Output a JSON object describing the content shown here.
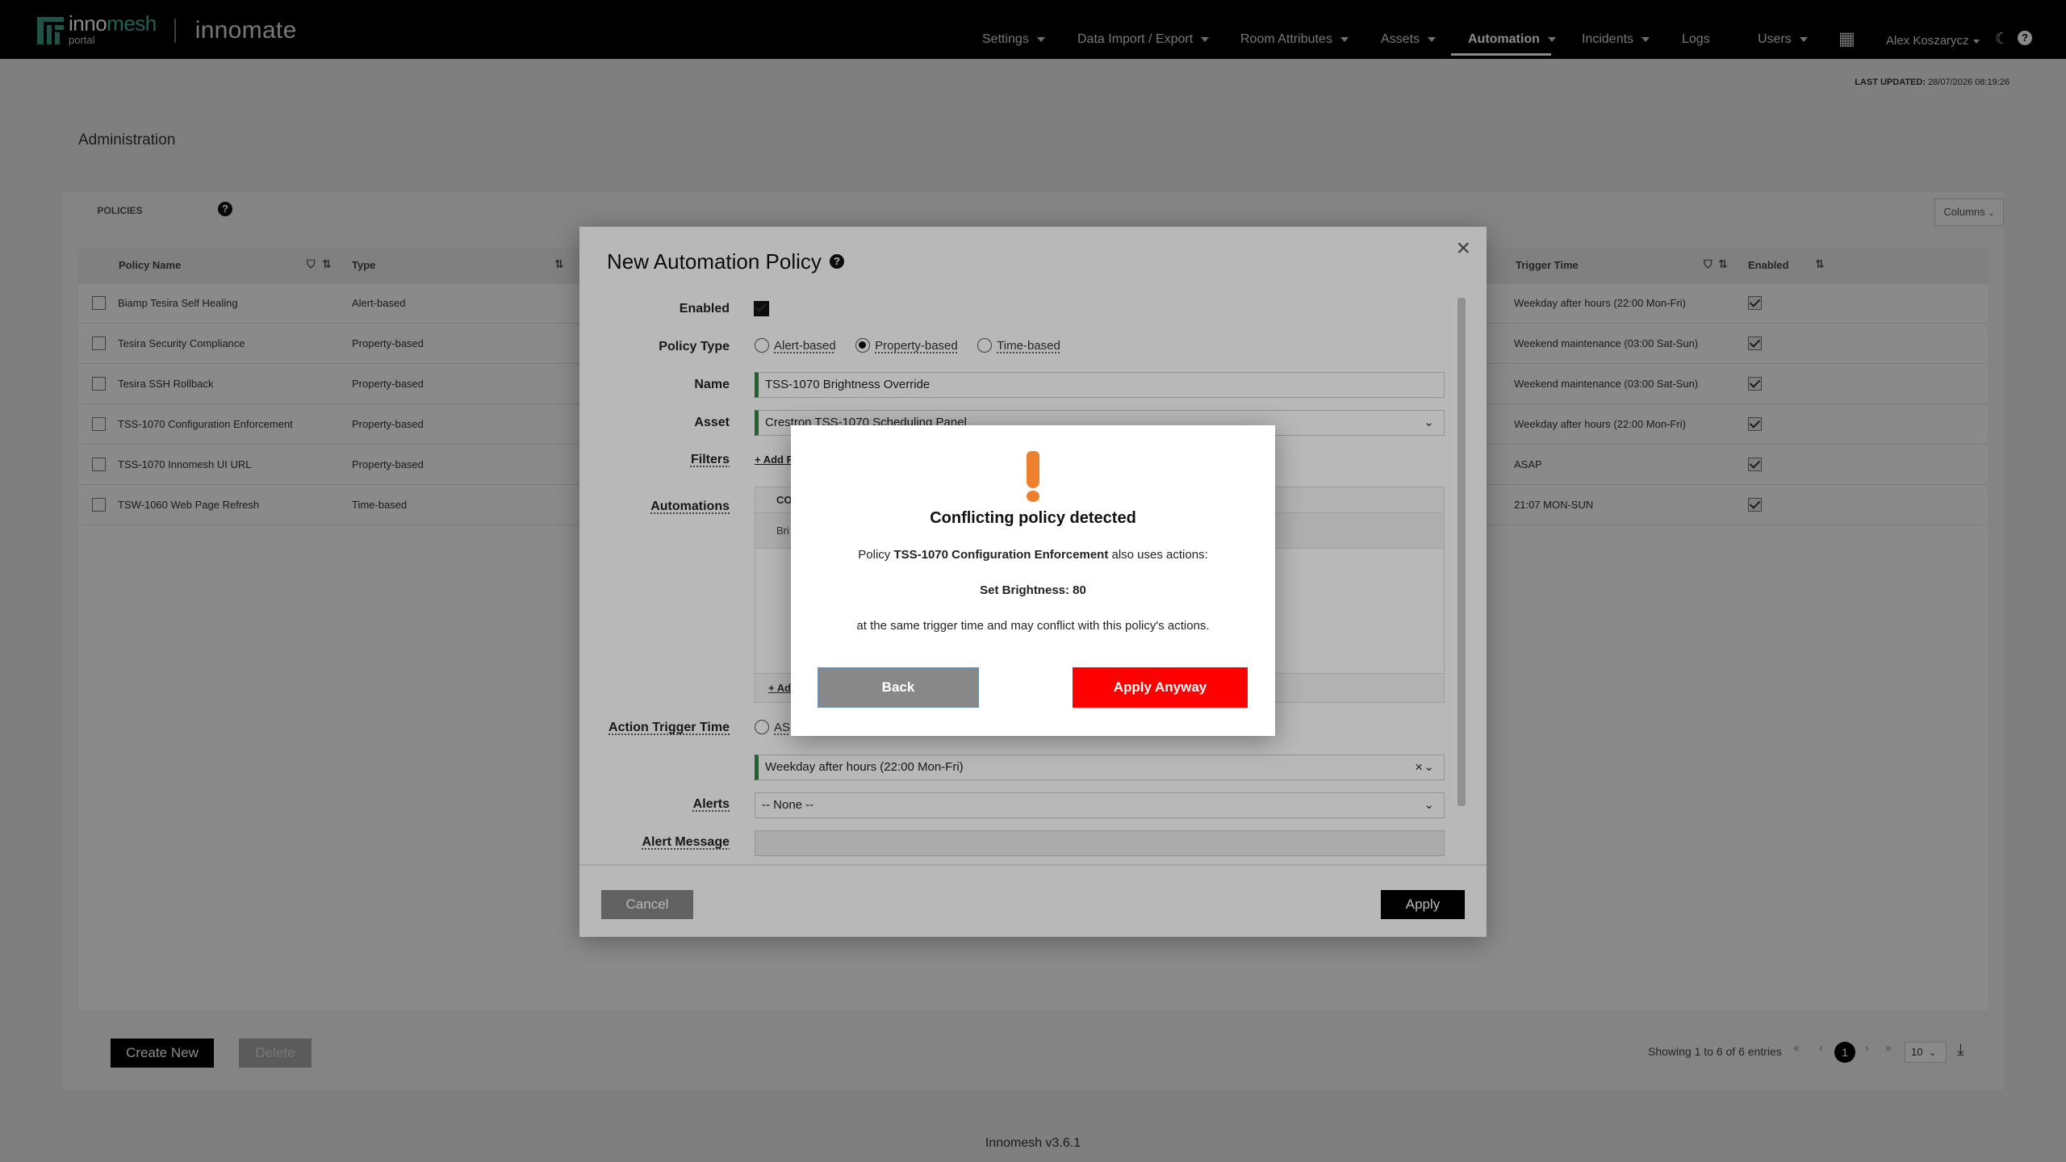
{
  "brand": {
    "logo_primary": "inno",
    "logo_accent": "mesh",
    "logo_sub": "portal",
    "product": "innomate"
  },
  "nav": {
    "items": [
      {
        "label": "Settings",
        "caret": true
      },
      {
        "label": "Data Import / Export",
        "caret": true
      },
      {
        "label": "Room Attributes",
        "caret": true
      },
      {
        "label": "Assets",
        "caret": true
      },
      {
        "label": "Automation",
        "caret": true,
        "active": true
      },
      {
        "label": "Incidents",
        "caret": true
      },
      {
        "label": "Logs",
        "caret": false
      },
      {
        "label": "Users",
        "caret": true
      }
    ],
    "user": "Alex Koszarycz",
    "icons": [
      "apps-grid-icon",
      "moon-icon",
      "help-icon"
    ]
  },
  "status": {
    "last_updated_label": "LAST UPDATED:",
    "last_updated_value": "28/07/2026 08:19:26"
  },
  "page": {
    "title": "Administration",
    "tab_policies": "POLICIES",
    "columns_button": "Columns"
  },
  "table": {
    "headers": {
      "policy_name": "Policy Name",
      "type": "Type",
      "trigger_time": "Trigger Time",
      "enabled": "Enabled"
    },
    "rows": [
      {
        "name": "Biamp Tesira Self Healing",
        "type": "Alert-based",
        "trigger": "Weekday after hours (22:00 Mon-Fri)",
        "enabled": true
      },
      {
        "name": "Tesira Security Compliance",
        "type": "Property-based",
        "trigger": "Weekend maintenance (03:00 Sat-Sun)",
        "enabled": true
      },
      {
        "name": "Tesira SSH Rollback",
        "type": "Property-based",
        "trigger": "Weekend maintenance (03:00 Sat-Sun)",
        "enabled": true
      },
      {
        "name": "TSS-1070 Configuration Enforcement",
        "type": "Property-based",
        "trigger": "Weekday after hours (22:00 Mon-Fri)",
        "enabled": true
      },
      {
        "name": "TSS-1070 Innomesh UI URL",
        "type": "Property-based",
        "trigger": "ASAP",
        "enabled": true
      },
      {
        "name": "TSW-1060 Web Page Refresh",
        "type": "Time-based",
        "trigger": "21:07 MON-SUN",
        "enabled": true
      }
    ]
  },
  "actions": {
    "create_new": "Create New",
    "delete": "Delete"
  },
  "pagination": {
    "summary": "Showing 1 to 6 of 6 entries",
    "current_page": "1",
    "page_size": "10"
  },
  "footer": {
    "version": "Innomesh v3.6.1"
  },
  "modal": {
    "title": "New Automation Policy",
    "labels": {
      "enabled": "Enabled",
      "policy_type": "Policy Type",
      "name": "Name",
      "asset": "Asset",
      "filters": "Filters",
      "automations": "Automations",
      "action_trigger_time": "Action Trigger Time",
      "alerts": "Alerts",
      "alert_message": "Alert Message"
    },
    "policy_types": [
      "Alert-based",
      "Property-based",
      "Time-based"
    ],
    "selected_policy_type": "Property-based",
    "name_value": "TSS-1070 Brightness Override",
    "asset_value": "Crestron TSS-1070 Scheduling Panel",
    "filters_link": "+ Add F",
    "automations_head": "CO",
    "automations_row": "Bri",
    "automations_add": "+ Ad",
    "trigger_option_asap": "AS",
    "trigger_value": "Weekday after hours (22:00 Mon-Fri)",
    "alerts_value": "-- None --",
    "cancel": "Cancel",
    "apply": "Apply"
  },
  "dialog": {
    "title": "Conflicting policy detected",
    "line1_prefix": "Policy",
    "line1_policy": "TSS-1070 Configuration Enforcement",
    "line1_suffix": "also uses actions:",
    "action": "Set Brightness: 80",
    "line3": "at the same trigger time and may conflict with this policy's actions.",
    "back": "Back",
    "apply_anyway": "Apply Anyway"
  },
  "colors": {
    "brand_accent": "#45b39d",
    "warning": "#ee7f2d",
    "danger": "#ff0000",
    "valid_field": "#2a8a3e"
  }
}
